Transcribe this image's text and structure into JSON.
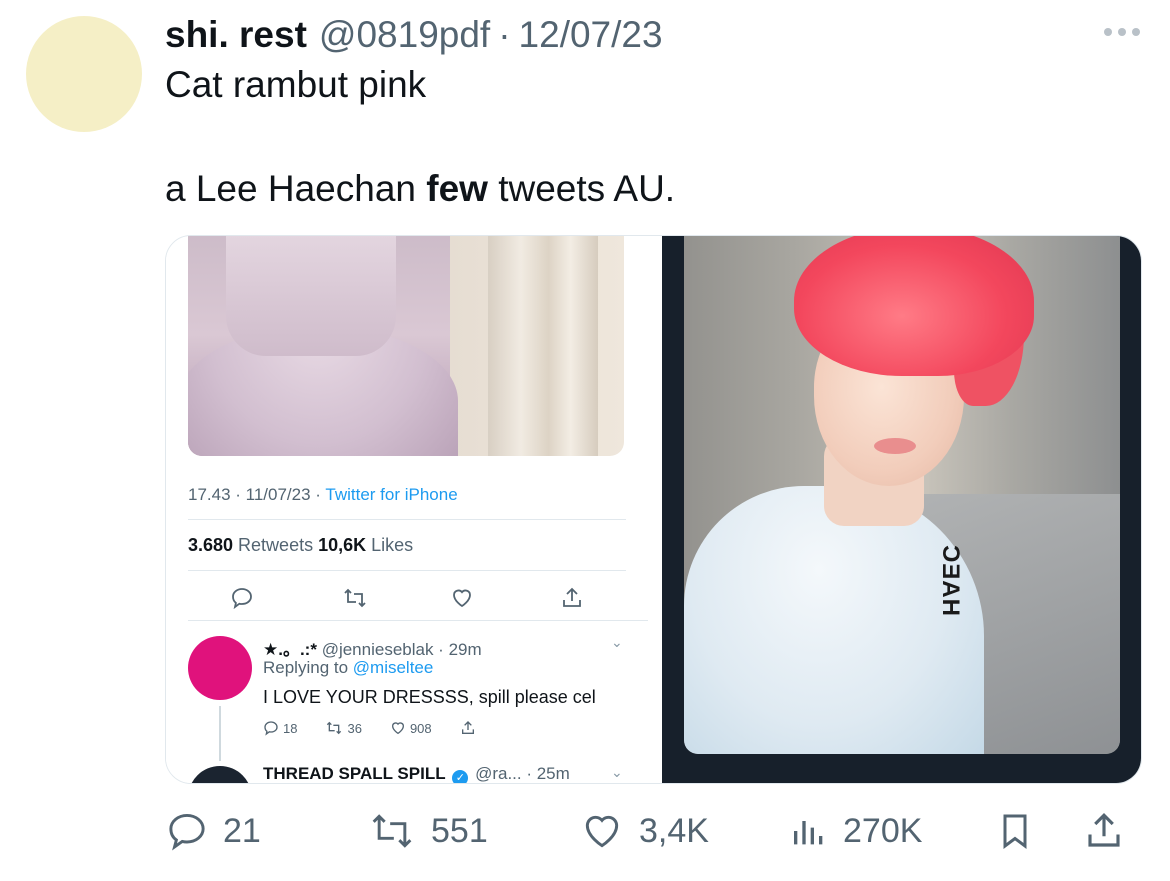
{
  "tweet": {
    "display_name": "shi. rest",
    "handle": "@0819pdf",
    "separator": "·",
    "date": "12/07/23",
    "line1": "Cat rambut pink",
    "line2_before": "a Lee Haechan ",
    "line2_bold": "few",
    "line2_after": " tweets AU."
  },
  "embedded": {
    "meta_time": "17.43 · 11/07/23 · ",
    "meta_via": "Twitter for iPhone",
    "retweets_count": "3.680",
    "retweets_label": " Retweets ",
    "likes_count": "10,6K",
    "likes_label": " Likes",
    "reply": {
      "name": "★.。.:*",
      "handle_time": " @jennieseblak · 29m",
      "replying_label": "Replying to ",
      "replying_to": "@miseltee",
      "body": "I LOVE YOUR DRESSSS, spill please cel",
      "reply_count": "18",
      "retweet_count": "36",
      "like_count": "908"
    },
    "reply2": {
      "name": "THREAD SPALL SPILL",
      "handle_time": " @ra... · 25m"
    },
    "shirt_print": "HAEC"
  },
  "actions": {
    "replies": "21",
    "retweets": "551",
    "likes": "3,4K",
    "views": "270K"
  },
  "colors": {
    "text": "#0f1419",
    "secondary": "#536471",
    "link": "#1d9bf0",
    "avatar": "#f5efc6"
  }
}
